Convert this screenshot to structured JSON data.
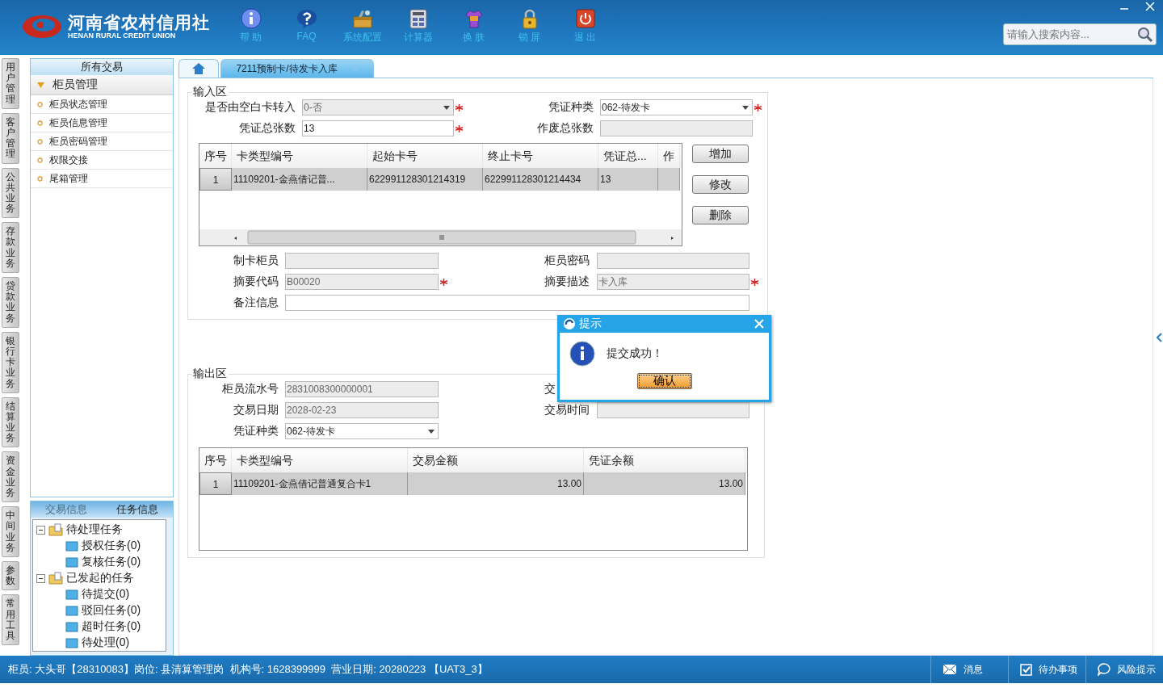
{
  "header": {
    "logo_cn": "河南省农村信用社",
    "logo_en": "HENAN RURAL CREDIT UNION",
    "toolbar": [
      {
        "label": "帮 助"
      },
      {
        "label": "FAQ"
      },
      {
        "label": "系统配置"
      },
      {
        "label": "计算器"
      },
      {
        "label": "换 肤"
      },
      {
        "label": "锁 屏"
      },
      {
        "label": "退 出"
      }
    ],
    "search": {
      "placeholder": "请输入搜索内容..."
    }
  },
  "side_tabs": [
    {
      "label": "用户管理"
    },
    {
      "label": "客户管理"
    },
    {
      "label": "公共业务"
    },
    {
      "label": "存款业务"
    },
    {
      "label": "贷款业务"
    },
    {
      "label": "银行卡业务"
    },
    {
      "label": "结算业务"
    },
    {
      "label": "资金业务"
    },
    {
      "label": "中间业务"
    },
    {
      "label": "参数"
    },
    {
      "label": "常用工具"
    }
  ],
  "nav": {
    "title": "所有交易",
    "group": {
      "label": "柜员管理",
      "expanded": true,
      "items": [
        {
          "label": "柜员状态管理"
        },
        {
          "label": "柜员信息管理"
        },
        {
          "label": "柜员密码管理"
        },
        {
          "label": "权限交接"
        },
        {
          "label": "尾箱管理"
        }
      ]
    }
  },
  "task_panel": {
    "tabs": [
      {
        "label": "交易信息",
        "selected": false
      },
      {
        "label": "任务信息",
        "selected": true
      }
    ],
    "tree": [
      {
        "label": "待处理任务",
        "expanded": true,
        "children": [
          {
            "label": "授权任务(0)"
          },
          {
            "label": "复核任务(0)"
          }
        ]
      },
      {
        "label": "已发起的任务",
        "expanded": true,
        "children": [
          {
            "label": "待提交(0)"
          },
          {
            "label": "驳回任务(0)"
          },
          {
            "label": "超时任务(0)"
          },
          {
            "label": "待处理(0)"
          }
        ]
      }
    ]
  },
  "tabs": [
    {
      "kind": "home",
      "selected": false
    },
    {
      "kind": "page",
      "label": "7211预制卡/待发卡入库",
      "selected": true
    }
  ],
  "input_area": {
    "legend": "输入区",
    "top_fields": [
      {
        "label": "是否由空白卡转入",
        "value": "0-否",
        "kind": "select",
        "disabled": true,
        "required": true
      },
      {
        "label": "凭证种类",
        "value": "062-待发卡",
        "kind": "select",
        "disabled": false,
        "required": true
      },
      {
        "label": "凭证总张数",
        "value": "13",
        "kind": "input",
        "disabled": false,
        "required": true
      },
      {
        "label": "作废总张数",
        "kind": "input",
        "disabled": true
      }
    ],
    "table": {
      "columns": [
        "序号",
        "卡类型编号",
        "起始卡号",
        "终止卡号",
        "凭证总...",
        "作"
      ],
      "rows": [
        {
          "selected": true,
          "cells": [
            "1",
            "11109201-金燕借记普...",
            "622991128301214319",
            "622991128301214434",
            "13",
            ""
          ]
        }
      ]
    },
    "buttons": [
      "增加",
      "修改",
      "删除"
    ],
    "bottom_fields": [
      {
        "label": "制卡柜员",
        "kind": "input",
        "disabled": true
      },
      {
        "label": "柜员密码",
        "kind": "input",
        "disabled": true
      },
      {
        "label": "摘要代码",
        "value": "B00020",
        "kind": "input",
        "disabled": true,
        "required": true
      },
      {
        "label": "摘要描述",
        "value": "卡入库",
        "kind": "input",
        "disabled": true,
        "required": true
      },
      {
        "label": "备注信息",
        "kind": "wide",
        "disabled": false
      }
    ]
  },
  "output_area": {
    "legend": "输出区",
    "fields": [
      {
        "label": "柜员流水号",
        "value": "2831008300000001",
        "kind": "input",
        "disabled": true
      },
      {
        "label": "交",
        "kind": "label"
      },
      {
        "label": "交易日期",
        "value": "2028-02-23",
        "kind": "input",
        "disabled": true
      },
      {
        "label": "交易时间",
        "kind": "input",
        "disabled": true
      },
      {
        "label": "凭证种类",
        "value": "062-待发卡",
        "kind": "select",
        "disabled": false
      }
    ],
    "table": {
      "columns": [
        "序号",
        "卡类型编号",
        "交易金额",
        "凭证余额"
      ],
      "rows": [
        {
          "selected": true,
          "cells": [
            "1",
            "11109201-金燕借记普通复合卡1",
            "13.00",
            "13.00"
          ]
        }
      ]
    }
  },
  "dialog": {
    "title": "提示",
    "message": "提交成功！",
    "button": "确认"
  },
  "status_bar": {
    "text": "柜员: 大头哥【28310083】岗位: 县清算管理岗  机构号: 1628399999  营业日期: 20280223 【UAT3_3】",
    "items": [
      {
        "label": "消息"
      },
      {
        "label": "待办事项"
      },
      {
        "label": "风险提示"
      }
    ]
  }
}
